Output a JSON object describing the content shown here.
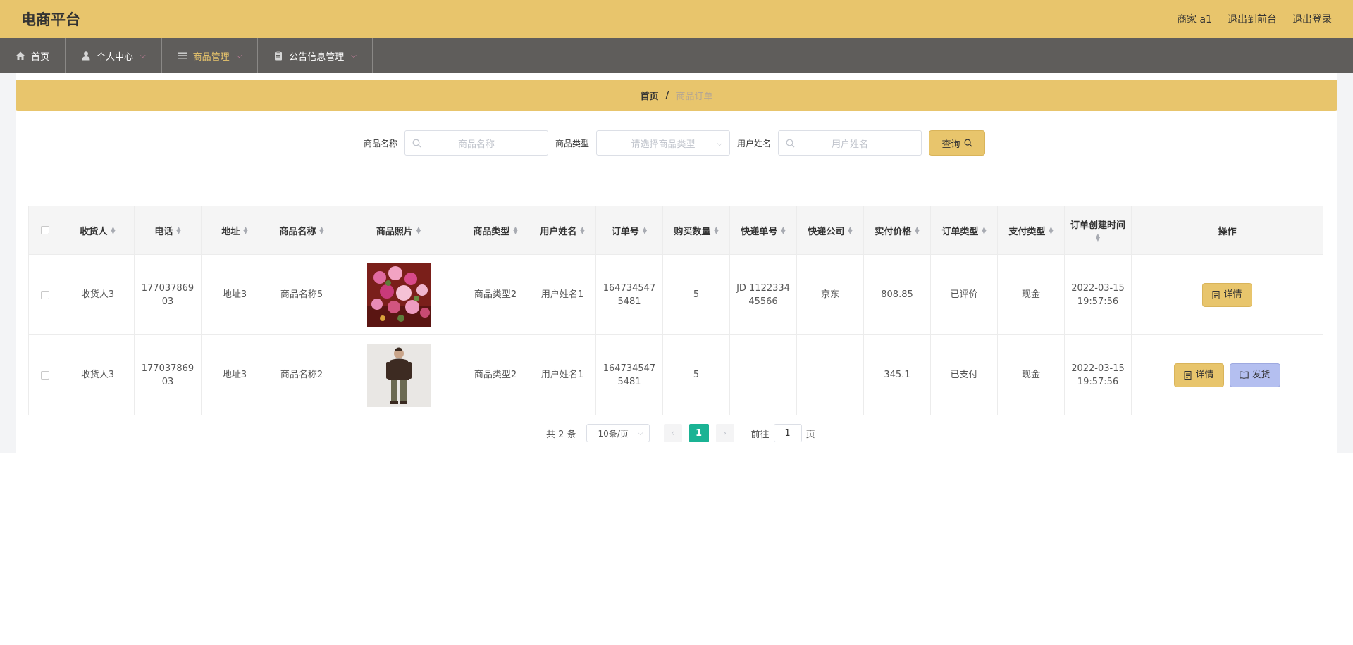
{
  "header": {
    "title": "电商平台",
    "user_label": "商家 a1",
    "to_front_label": "退出到前台",
    "logout_label": "退出登录"
  },
  "nav": {
    "items": [
      {
        "label": "首页",
        "icon": "home-icon",
        "dropdown": false,
        "active": false
      },
      {
        "label": "个人中心",
        "icon": "user-icon",
        "dropdown": true,
        "active": false
      },
      {
        "label": "商品管理",
        "icon": "menu-icon",
        "dropdown": true,
        "active": true
      },
      {
        "label": "公告信息管理",
        "icon": "clipboard-icon",
        "dropdown": true,
        "active": false
      }
    ]
  },
  "breadcrumb": {
    "home": "首页",
    "separator": "/",
    "current": "商品订单"
  },
  "search": {
    "product_name_label": "商品名称",
    "product_name_placeholder": "商品名称",
    "product_type_label": "商品类型",
    "product_type_placeholder": "请选择商品类型",
    "user_name_label": "用户姓名",
    "user_name_placeholder": "用户姓名",
    "query_label": "查询"
  },
  "table": {
    "columns": [
      {
        "label": "收货人",
        "sortable": true
      },
      {
        "label": "电话",
        "sortable": true
      },
      {
        "label": "地址",
        "sortable": true
      },
      {
        "label": "商品名称",
        "sortable": true
      },
      {
        "label": "商品照片",
        "sortable": true
      },
      {
        "label": "商品类型",
        "sortable": true
      },
      {
        "label": "用户姓名",
        "sortable": true
      },
      {
        "label": "订单号",
        "sortable": true
      },
      {
        "label": "购买数量",
        "sortable": true
      },
      {
        "label": "快递单号",
        "sortable": true
      },
      {
        "label": "快递公司",
        "sortable": true
      },
      {
        "label": "实付价格",
        "sortable": true
      },
      {
        "label": "订单类型",
        "sortable": true
      },
      {
        "label": "支付类型",
        "sortable": true
      },
      {
        "label": "订单创建时间",
        "sortable": true
      },
      {
        "label": "操作",
        "sortable": false
      }
    ],
    "rows": [
      {
        "receiver": "收货人3",
        "phone": "17703786903",
        "address": "地址3",
        "product_name": "商品名称5",
        "photo": "flower-bouquet-image",
        "product_type": "商品类型2",
        "user_name": "用户姓名1",
        "order_no": "1647345475481",
        "quantity": "5",
        "tracking_no": "JD 112233445566",
        "courier": "京东",
        "price": "808.85",
        "order_status": "已评价",
        "pay_type": "现金",
        "created_at": "2022-03-15 19:57:56",
        "actions": [
          "详情"
        ]
      },
      {
        "receiver": "收货人3",
        "phone": "17703786903",
        "address": "地址3",
        "product_name": "商品名称2",
        "photo": "man-jacket-image",
        "product_type": "商品类型2",
        "user_name": "用户姓名1",
        "order_no": "1647345475481",
        "quantity": "5",
        "tracking_no": "",
        "courier": "",
        "price": "345.1",
        "order_status": "已支付",
        "pay_type": "现金",
        "created_at": "2022-03-15 19:57:56",
        "actions": [
          "详情",
          "发货"
        ]
      }
    ]
  },
  "pagination": {
    "total_label": "共 2 条",
    "page_size": "10条/页",
    "current_page": "1",
    "goto_label": "前往",
    "goto_value": "1",
    "page_suffix": "页"
  },
  "colors": {
    "accent": "#e8c56c",
    "nav_bg": "#5f5d5b",
    "page_active": "#1ab394",
    "ship_btn": "#b4bff0"
  }
}
